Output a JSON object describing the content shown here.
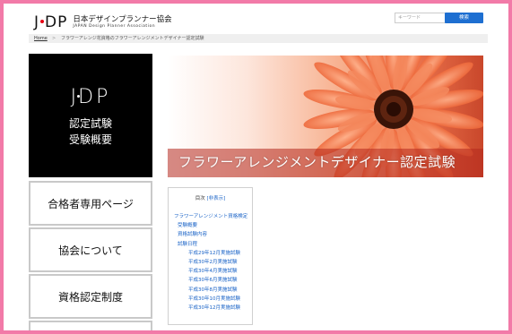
{
  "header": {
    "logo_mark": "JDP",
    "logo_jp": "日本デザインプランナー協会",
    "logo_en": "JAPAN Design Planner Association",
    "search_placeholder": "キーワード",
    "search_button": "検索"
  },
  "breadcrumb": {
    "home": "Home",
    "separator": ">",
    "current": "フラワーアレンジ花資格のフラワーアレンジメントデザイナー認定試験"
  },
  "sidebar": {
    "hero_logo": "JDP",
    "hero_line1": "認定試験",
    "hero_line2": "受験概要",
    "items": [
      {
        "label": "合格者専用ページ"
      },
      {
        "label": "協会について"
      },
      {
        "label": "資格認定制度"
      }
    ]
  },
  "banner": {
    "title": "フラワーアレンジメントデザイナー認定試験"
  },
  "toc": {
    "title": "目次",
    "toggle": "[非表示]",
    "items": [
      {
        "label": "フラワーアレンジメント資格検定",
        "level": 1
      },
      {
        "label": "受験概要",
        "level": 2
      },
      {
        "label": "資格試験内容",
        "level": 2
      },
      {
        "label": "試験日程",
        "level": 2
      },
      {
        "label": "平成29年12月実施試験",
        "level": 3
      },
      {
        "label": "平成30年2月実施試験",
        "level": 3
      },
      {
        "label": "平成30年4月実施試験",
        "level": 3
      },
      {
        "label": "平成30年6月実施試験",
        "level": 3
      },
      {
        "label": "平成30年8月実施試験",
        "level": 3
      },
      {
        "label": "平成30年10月実施試験",
        "level": 3
      },
      {
        "label": "平成30年12月実施試験",
        "level": 3
      }
    ]
  },
  "colors": {
    "frame_border": "#f27aa8",
    "search_button": "#1e6fd1",
    "link": "#1a63c7",
    "sidebar_hero_bg": "#000000"
  }
}
